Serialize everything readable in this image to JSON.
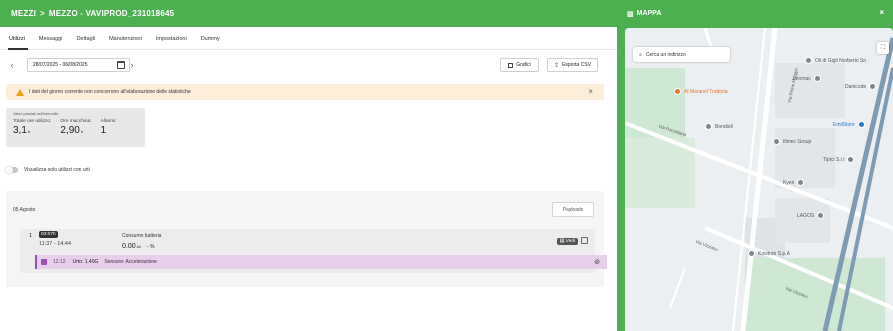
{
  "header": {
    "section": "MEZZI",
    "separator": ">",
    "title": "MEZZO - VAVIPROD_231018645"
  },
  "tabs": [
    {
      "label": "Utilizzi",
      "active": true
    },
    {
      "label": "Messaggi",
      "active": false
    },
    {
      "label": "Dettagli",
      "active": false
    },
    {
      "label": "Manutenzioni",
      "active": false
    },
    {
      "label": "Impostazioni",
      "active": false
    },
    {
      "label": "Dummy",
      "active": false
    }
  ],
  "toolbar": {
    "prev": "‹",
    "next": "›",
    "date_range": "28/07/2025 - 06/08/2025",
    "charts_label": "Grafici",
    "export_label": "Esporta CSV"
  },
  "alert": {
    "text": "I dati del giorno corrente non concorrono all'elaborazione delle statistiche",
    "close": "×",
    "color": "#fdeed9"
  },
  "stats": {
    "caption": "Valori parziali nell'intervallo",
    "total_usage_label": "Totale ore utilizzo:",
    "total_usage_value": "3,1",
    "total_usage_unit": "h",
    "machine_hours_label": "Ore macchina:",
    "machine_hours_value": "2,90",
    "machine_hours_unit": "h",
    "alarms_label": "Allarmi:",
    "alarms_value": "1"
  },
  "filter": {
    "toggle_label": "Visualizza solo utilizzi con urti",
    "enabled": false
  },
  "day": {
    "date": "05 Agosto",
    "payloads_label": "Payloads",
    "entries": [
      {
        "index": "1",
        "duration": "03:07h",
        "interval": "11:37 - 14:44",
        "battery_label": "Consumo batteria",
        "battery_value": "0.00",
        "battery_unit": "Ah",
        "battery_pct": "- %",
        "view_label": "Vedi",
        "sensor": {
          "time": "12:12",
          "impact": "Urto: 1.40G",
          "type": "Sensore: Accelerazione"
        }
      }
    ]
  },
  "map": {
    "title": "MAPPA",
    "close": "×",
    "search_placeholder": "Cerca un indirizzo",
    "pois": [
      {
        "name": "Al Maranel Trattoria",
        "icon": "restaurant-icon"
      },
      {
        "name": "Oil di Gigli Norberto Sn",
        "icon": "pin-icon"
      },
      {
        "name": "Lenmac",
        "icon": "pin-icon"
      },
      {
        "name": "Danicode",
        "icon": "pin-icon"
      },
      {
        "name": "Bondioli",
        "icon": "pin-icon"
      },
      {
        "name": "Illmec Group",
        "icon": "pin-icon"
      },
      {
        "name": "EmilStore",
        "icon": "shop-icon"
      },
      {
        "name": "Tipici S.r.l",
        "icon": "pin-icon"
      },
      {
        "name": "Kyen",
        "icon": "pin-icon"
      },
      {
        "name": "LAGOS",
        "icon": "pin-icon"
      },
      {
        "name": "Kowtron S.p.A",
        "icon": "pin-icon"
      }
    ],
    "roads": [
      "Via Porcellana",
      "Via Primo Maggio",
      "Via Vizzano",
      "Via Vizzano"
    ],
    "accent": "#4caf50"
  }
}
